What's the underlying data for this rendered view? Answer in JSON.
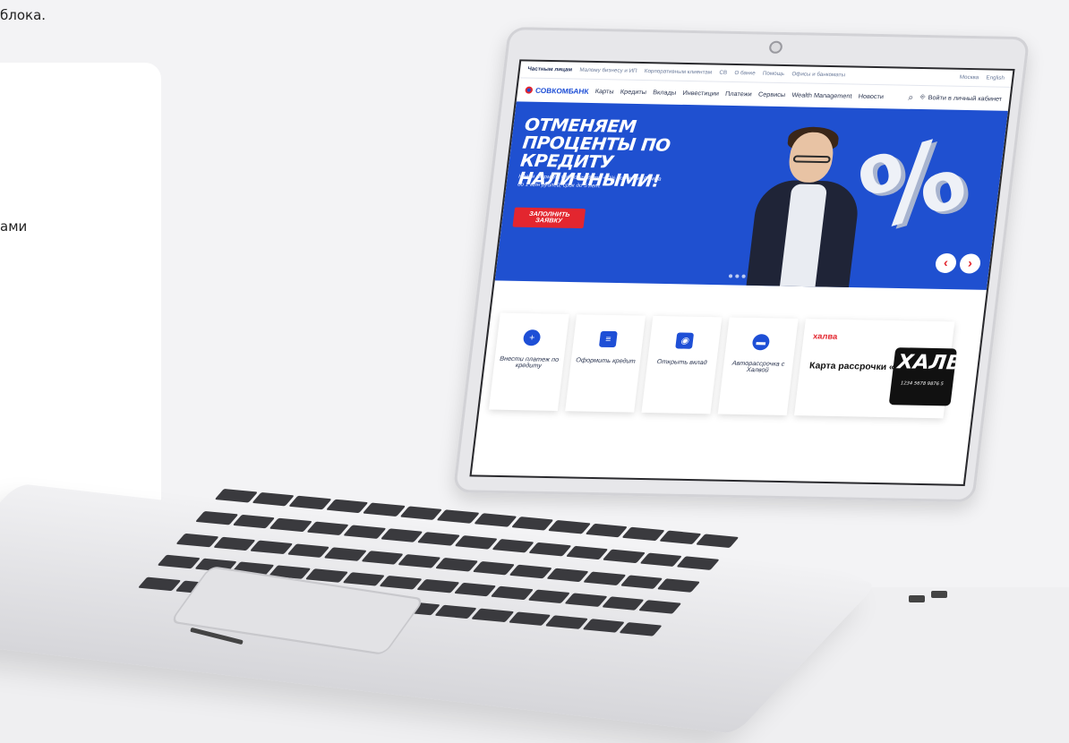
{
  "page_fragments": {
    "top_text": "блока.",
    "side_text": "ами"
  },
  "site": {
    "topbar": {
      "items": [
        "Частным лицам",
        "Малому бизнесу и ИП",
        "Корпоративным клиентам",
        "СВ",
        "О банке",
        "Помощь",
        "Офисы и банкоматы"
      ],
      "right": [
        "Москва",
        "English"
      ]
    },
    "logo": "СОВКОМБАНК",
    "nav": [
      "Карты",
      "Кредиты",
      "Вклады",
      "Инвестиции",
      "Платежи",
      "Сервисы",
      "Wealth Management",
      "Новости"
    ],
    "login_label": "Войти в личный кабинет",
    "hero": {
      "title": "ОТМЕНЯЕМ ПРОЦЕНТЫ ПО КРЕДИТУ НАЛИЧНЫМИ!",
      "subtitle": "Новая формула 0% по кредиту + 0% по Халве. Сумма до 1 млн рублей, срок до 5 лет.",
      "cta": "ЗАПОЛНИТЬ ЗАЯВКУ",
      "graphic": "%"
    },
    "tiles": [
      {
        "label": "Внести платеж по кредиту",
        "icon": "plus-circle-icon"
      },
      {
        "label": "Оформить кредит",
        "icon": "document-icon"
      },
      {
        "label": "Открыть вклад",
        "icon": "safe-icon"
      },
      {
        "label": "Авторассрочка с Халвой",
        "icon": "car-icon"
      }
    ],
    "halva": {
      "logo": "халва",
      "title": "Карта рассрочки «Халва»",
      "card_text": "ХАЛВ",
      "card_number": "1234 5678 9876 5"
    }
  },
  "colors": {
    "brand_blue": "#1f50d0",
    "brand_red": "#e3262f"
  }
}
